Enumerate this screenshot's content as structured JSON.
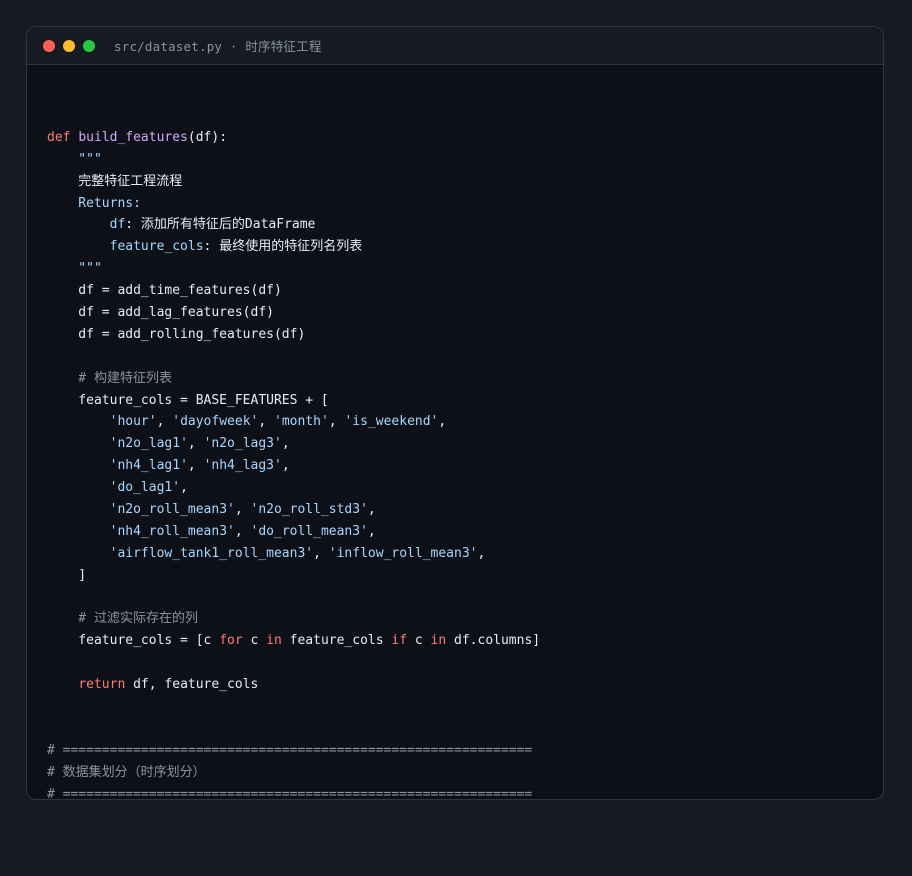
{
  "window": {
    "title": "src/dataset.py · 时序特征工程",
    "colors": {
      "background": "#0d1117",
      "titlebar": "#161b22",
      "keyword": "#ff7b72",
      "function": "#d2a8ff",
      "string": "#a5d6ff",
      "comment": "#8b949e",
      "text": "#e6edf3",
      "close": "#ff5f56",
      "minimize": "#ffbd2e",
      "maximize": "#27c93f"
    }
  },
  "code": {
    "lines": [
      [],
      [
        {
          "t": "kw",
          "v": "def "
        },
        {
          "t": "fn",
          "v": "build_features"
        },
        {
          "t": "pl",
          "v": "(df):"
        }
      ],
      [
        {
          "t": "doc",
          "v": "    \"\"\""
        }
      ],
      [
        {
          "t": "pl",
          "v": "    完整特征工程流程"
        }
      ],
      [
        {
          "t": "doc",
          "v": "    Returns:"
        }
      ],
      [
        {
          "t": "doc",
          "v": "        df"
        },
        {
          "t": "pl",
          "v": ": 添加所有特征后的DataFrame"
        }
      ],
      [
        {
          "t": "doc",
          "v": "        feature_cols"
        },
        {
          "t": "pl",
          "v": ": 最终使用的特征列名列表"
        }
      ],
      [
        {
          "t": "doc",
          "v": "    \"\"\""
        }
      ],
      [
        {
          "t": "pl",
          "v": "    df = add_time_features(df)"
        }
      ],
      [
        {
          "t": "pl",
          "v": "    df = add_lag_features(df)"
        }
      ],
      [
        {
          "t": "pl",
          "v": "    df = add_rolling_features(df)"
        }
      ],
      [],
      [
        {
          "t": "cm",
          "v": "    # 构建特征列表"
        }
      ],
      [
        {
          "t": "pl",
          "v": "    feature_cols = BASE_FEATURES + ["
        }
      ],
      [
        {
          "t": "pl",
          "v": "        "
        },
        {
          "t": "str",
          "v": "'hour'"
        },
        {
          "t": "pl",
          "v": ", "
        },
        {
          "t": "str",
          "v": "'dayofweek'"
        },
        {
          "t": "pl",
          "v": ", "
        },
        {
          "t": "str",
          "v": "'month'"
        },
        {
          "t": "pl",
          "v": ", "
        },
        {
          "t": "str",
          "v": "'is_weekend'"
        },
        {
          "t": "pl",
          "v": ","
        }
      ],
      [
        {
          "t": "pl",
          "v": "        "
        },
        {
          "t": "str",
          "v": "'n2o_lag1'"
        },
        {
          "t": "pl",
          "v": ", "
        },
        {
          "t": "str",
          "v": "'n2o_lag3'"
        },
        {
          "t": "pl",
          "v": ","
        }
      ],
      [
        {
          "t": "pl",
          "v": "        "
        },
        {
          "t": "str",
          "v": "'nh4_lag1'"
        },
        {
          "t": "pl",
          "v": ", "
        },
        {
          "t": "str",
          "v": "'nh4_lag3'"
        },
        {
          "t": "pl",
          "v": ","
        }
      ],
      [
        {
          "t": "pl",
          "v": "        "
        },
        {
          "t": "str",
          "v": "'do_lag1'"
        },
        {
          "t": "pl",
          "v": ","
        }
      ],
      [
        {
          "t": "pl",
          "v": "        "
        },
        {
          "t": "str",
          "v": "'n2o_roll_mean3'"
        },
        {
          "t": "pl",
          "v": ", "
        },
        {
          "t": "str",
          "v": "'n2o_roll_std3'"
        },
        {
          "t": "pl",
          "v": ","
        }
      ],
      [
        {
          "t": "pl",
          "v": "        "
        },
        {
          "t": "str",
          "v": "'nh4_roll_mean3'"
        },
        {
          "t": "pl",
          "v": ", "
        },
        {
          "t": "str",
          "v": "'do_roll_mean3'"
        },
        {
          "t": "pl",
          "v": ","
        }
      ],
      [
        {
          "t": "pl",
          "v": "        "
        },
        {
          "t": "str",
          "v": "'airflow_tank1_roll_mean3'"
        },
        {
          "t": "pl",
          "v": ", "
        },
        {
          "t": "str",
          "v": "'inflow_roll_mean3'"
        },
        {
          "t": "pl",
          "v": ","
        }
      ],
      [
        {
          "t": "pl",
          "v": "    ]"
        }
      ],
      [],
      [
        {
          "t": "cm",
          "v": "    # 过滤实际存在的列"
        }
      ],
      [
        {
          "t": "pl",
          "v": "    feature_cols = [c "
        },
        {
          "t": "kw",
          "v": "for"
        },
        {
          "t": "pl",
          "v": " c "
        },
        {
          "t": "kw",
          "v": "in"
        },
        {
          "t": "pl",
          "v": " feature_cols "
        },
        {
          "t": "kw",
          "v": "if"
        },
        {
          "t": "pl",
          "v": " c "
        },
        {
          "t": "kw",
          "v": "in"
        },
        {
          "t": "pl",
          "v": " df.columns]"
        }
      ],
      [],
      [
        {
          "t": "pl",
          "v": "    "
        },
        {
          "t": "kw",
          "v": "return"
        },
        {
          "t": "pl",
          "v": " df, feature_cols"
        }
      ],
      [],
      [],
      [
        {
          "t": "cm",
          "v": "# ============================================================"
        }
      ],
      [
        {
          "t": "cm",
          "v": "# 数据集划分（时序划分）"
        }
      ],
      [
        {
          "t": "cm",
          "v": "# ============================================================"
        }
      ]
    ]
  }
}
